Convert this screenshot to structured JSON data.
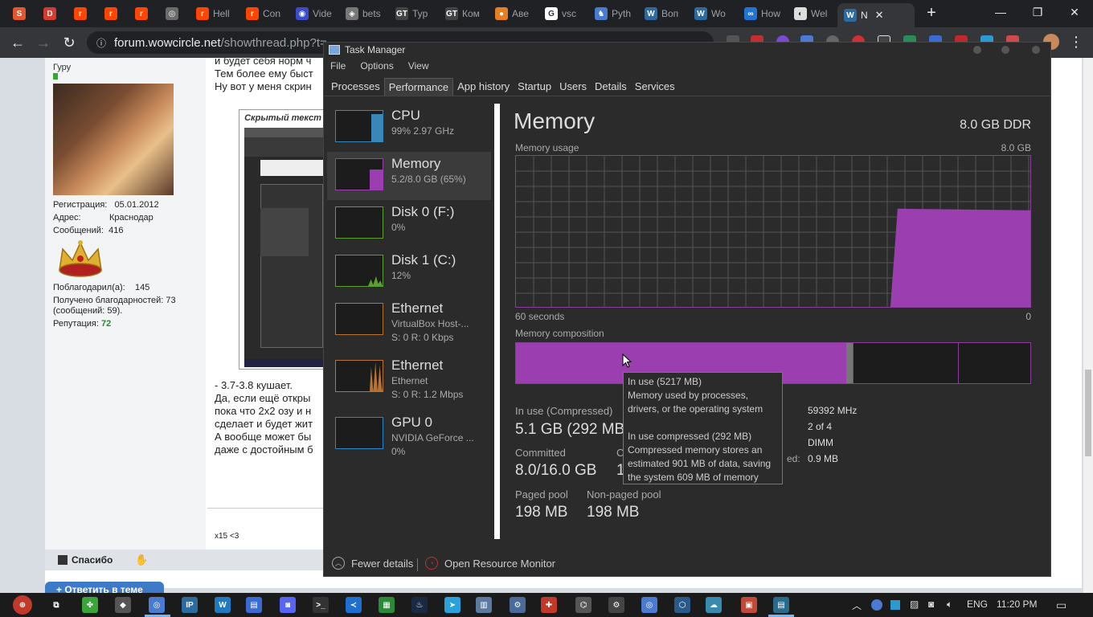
{
  "browser": {
    "tabs": [
      {
        "title": "",
        "color": "#e4572e",
        "glyph": "S"
      },
      {
        "title": "",
        "color": "#d73a2f",
        "glyph": "D"
      },
      {
        "title": "",
        "color": "#ff4500",
        "glyph": "r"
      },
      {
        "title": "",
        "color": "#ff4500",
        "glyph": "r"
      },
      {
        "title": "",
        "color": "#ff4500",
        "glyph": "r"
      },
      {
        "title": "",
        "color": "#6b6b6b",
        "glyph": "◎"
      },
      {
        "title": "Hell",
        "color": "#ff4500",
        "glyph": "r"
      },
      {
        "title": "Con",
        "color": "#ff4500",
        "glyph": "r"
      },
      {
        "title": "Vide",
        "color": "#3b4cca",
        "glyph": "◉"
      },
      {
        "title": "bets",
        "color": "#777777",
        "glyph": "◈"
      },
      {
        "title": "Typ",
        "color": "#444444",
        "glyph": "GT"
      },
      {
        "title": "Ком",
        "color": "#444444",
        "glyph": "GT"
      },
      {
        "title": "Аве",
        "color": "#e67e22",
        "glyph": "●"
      },
      {
        "title": "vsc",
        "color": "#ffffff",
        "glyph": "G"
      },
      {
        "title": "Pyth",
        "color": "#4a7bd0",
        "glyph": "♞"
      },
      {
        "title": "Воп",
        "color": "#2d6aa0",
        "glyph": "W"
      },
      {
        "title": "Wo",
        "color": "#2d6aa0",
        "glyph": "W"
      },
      {
        "title": "How",
        "color": "#1f74d6",
        "glyph": "∞"
      },
      {
        "title": "Wel",
        "color": "#dddddd",
        "glyph": "◐"
      },
      {
        "title": "N",
        "color": "#2d6aa0",
        "glyph": "W"
      }
    ],
    "new_tab": "+",
    "window_controls": {
      "minimize": "—",
      "restore": "❐",
      "close": "✕"
    },
    "url_host": "forum.wowcircle.net",
    "url_path": "/showthread.php?t=..."
  },
  "forum": {
    "user": {
      "rank": "Гуру",
      "reg_label": "Регистрация:",
      "reg_value": "05.01.2012",
      "addr_label": "Адрес:",
      "addr_value": "Краснодар",
      "msgs_label": "Сообщений:",
      "msgs_value": "416",
      "thanked_label": "Поблагодарил(а):",
      "thanked_value": "145",
      "received_line1": "Получено благодарностей: 73",
      "received_line2": "(сообщений: 59).",
      "rep_label": "Репутация:",
      "rep_value": "72"
    },
    "text_top": [
      "и будет себя норм ч",
      "Тем более ему быст",
      "Ну вот у меня скрин"
    ],
    "spoiler_title": "Скрытый текст",
    "text_bottom": [
      "- 3.7-3.8 кушает.",
      "Да, если ещё откры",
      "пока что 2х2 озу и н",
      "сделает и будет жит",
      "А вообще может бы",
      "даже с достойным б"
    ],
    "signature": "x15 <3",
    "thanks_label": "Спасибо",
    "reply_label": "+ Ответить в теме"
  },
  "taskmanager": {
    "title": "Task Manager",
    "menu": [
      "File",
      "Options",
      "View"
    ],
    "tabs": [
      "Processes",
      "Performance",
      "App history",
      "Startup",
      "Users",
      "Details",
      "Services"
    ],
    "selected_tab": "Performance",
    "sidebar": [
      {
        "title": "CPU",
        "sub1": "99%  2.97 GHz",
        "sub2": "",
        "color": "#3a86b8",
        "level": 0.9
      },
      {
        "title": "Memory",
        "sub1": "5.2/8.0 GB (65%)",
        "sub2": "",
        "color": "#9b3fb0",
        "level": 0.65
      },
      {
        "title": "Disk 0 (F:)",
        "sub1": "0%",
        "sub2": "",
        "color": "#5aa02c",
        "level": 0.0
      },
      {
        "title": "Disk 1 (C:)",
        "sub1": "12%",
        "sub2": "",
        "color": "#5aa02c",
        "level": 0.12
      },
      {
        "title": "Ethernet",
        "sub1": "VirtualBox Host-...",
        "sub2": "S: 0  R: 0 Kbps",
        "color": "#b87333",
        "level": 0.0
      },
      {
        "title": "Ethernet",
        "sub1": "Ethernet",
        "sub2": "S: 0  R: 1.2 Mbps",
        "color": "#b87333",
        "level": 0.3
      },
      {
        "title": "GPU 0",
        "sub1": "NVIDIA GeForce ...",
        "sub2": "0%",
        "color": "#2a88c8",
        "level": 0.0
      }
    ],
    "selected_resource": "Memory",
    "main": {
      "title": "Memory",
      "spec": "8.0 GB DDR",
      "usage_label": "Memory usage",
      "usage_max": "8.0 GB",
      "time_label": "60 seconds",
      "time_end": "0",
      "composition_label": "Memory composition",
      "usage_fraction": 0.65,
      "in_use_label": "In use (Compressed)",
      "in_use_value": "5.1 GB (292 MB)",
      "committed_label": "Committed",
      "committed_value": "8.0/16.0 GB",
      "cached_label": "C",
      "cached_value": "1",
      "paged_label": "Paged pool",
      "paged_value": "198 MB",
      "nonpaged_label": "Non-paged pool",
      "nonpaged_value": "198 MB",
      "speed_value": "59392 MHz",
      "slots_value": "2 of 4",
      "form_value": "DIMM",
      "hw_label": "ed:",
      "hw_value": "0.9 MB"
    },
    "tooltip": {
      "l1": "In use (5217 MB)",
      "l2": "Memory used by processes,",
      "l3": "drivers, or the operating system",
      "l4": "In use compressed (292 MB)",
      "l5": "Compressed memory stores an",
      "l6": "estimated 901 MB of data, saving",
      "l7": "the system 609 MB of memory"
    },
    "footer": {
      "fewer": "Fewer details",
      "monitor": "Open Resource Monitor"
    }
  },
  "taskbar": {
    "icons": [
      {
        "name": "start-icon",
        "color": "#c0392b",
        "glyph": "⊕"
      },
      {
        "name": "task-view-icon",
        "color": "#1b1b1b",
        "glyph": "⧉"
      },
      {
        "name": "clover-icon",
        "color": "#3aa33a",
        "glyph": "✤"
      },
      {
        "name": "app-icon",
        "color": "#555555",
        "glyph": "◆"
      },
      {
        "name": "chrome-icon",
        "color": "#4a7bd0",
        "glyph": "◎"
      },
      {
        "name": "ip-icon",
        "color": "#2d6aa0",
        "glyph": "IP"
      },
      {
        "name": "w-icon",
        "color": "#1f7ac0",
        "glyph": "W"
      },
      {
        "name": "file-icon",
        "color": "#3a6bd0",
        "glyph": "▤"
      },
      {
        "name": "discord-icon",
        "color": "#5865f2",
        "glyph": "◙"
      },
      {
        "name": "terminal-icon",
        "color": "#333333",
        "glyph": ">_"
      },
      {
        "name": "vscode-icon",
        "color": "#1f6fd0",
        "glyph": "≺"
      },
      {
        "name": "colorful-icon",
        "color": "#2a8a3a",
        "glyph": "▦"
      },
      {
        "name": "steam-icon",
        "color": "#1a2a44",
        "glyph": "♨"
      },
      {
        "name": "telegram-icon",
        "color": "#2aa1da",
        "glyph": "➤"
      },
      {
        "name": "notes-icon",
        "color": "#5a7aa0",
        "glyph": "▥"
      },
      {
        "name": "gear-alt-icon",
        "color": "#4a6a9a",
        "glyph": "⚙"
      },
      {
        "name": "redapp-icon",
        "color": "#c0392b",
        "glyph": "✚"
      },
      {
        "name": "usb-icon",
        "color": "#555555",
        "glyph": "⌬"
      },
      {
        "name": "settings-icon",
        "color": "#444444",
        "glyph": "⚙"
      },
      {
        "name": "chrome2-icon",
        "color": "#4a7bd0",
        "glyph": "◎"
      },
      {
        "name": "box-icon",
        "color": "#2a5a8a",
        "glyph": "⬡"
      },
      {
        "name": "cloud-icon",
        "color": "#3a8ab0",
        "glyph": "☁"
      },
      {
        "name": "image-icon",
        "color": "#c04a3a",
        "glyph": "▣"
      },
      {
        "name": "taskmgr-icon",
        "color": "#2a6a8a",
        "glyph": "▤"
      }
    ],
    "lang": "ENG",
    "time": "11:20 PM"
  }
}
